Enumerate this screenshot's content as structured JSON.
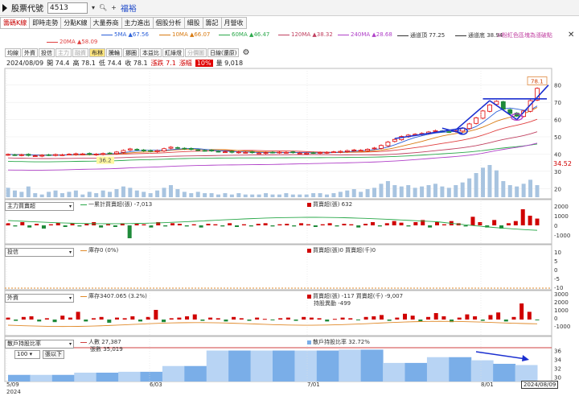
{
  "toolbar": {
    "label": "股票代號",
    "code": "4513",
    "stock_name": "福裕"
  },
  "tabs": [
    "籌碼K線",
    "即時走勢",
    "分點K線",
    "大量券商",
    "主力進出",
    "個股分析",
    "細股",
    "籌記",
    "月營收"
  ],
  "ma_legend": {
    "ma5": "5MA ▲67.56",
    "ma10": "10MA ▲66.07",
    "ma60": "60MA ▲46.47",
    "ma120": "120MA ▲38.32",
    "ma240": "240MA ▲28.68",
    "upper": "通道頂 77.25",
    "lower": "通道底 38.94",
    "ma20": "20MA ▲58.09",
    "link": "⊙粉紅色區塊為漲破點",
    "colors": {
      "ma5": "#2a5fd8",
      "ma10": "#d87a10",
      "ma60": "#2aa84a",
      "ma120": "#c04060",
      "ma240": "#b040c8",
      "upper": "#333333",
      "lower": "#333333",
      "ma20": "#e04040"
    }
  },
  "subtabs": [
    "均線",
    "外資",
    "投信",
    "主力",
    "融資",
    "布林",
    "騰輪",
    "挪圈",
    "本益比",
    "紅綠燈",
    "分價圖",
    "日線(還原)"
  ],
  "quote": {
    "date": "2024/08/09",
    "open": "開 74.4",
    "high": "高 78.1",
    "low": "低 74.4",
    "close": "收 78.1",
    "change": "漲跌 7.1",
    "pct_label": "漲幅",
    "pct": "10%",
    "volume": "量 9,018"
  },
  "price_axis": [
    "80",
    "70",
    "60",
    "50",
    "40",
    "30",
    "20"
  ],
  "price_tags": {
    "high": "78.1",
    "low": "36.2",
    "level": "34.52"
  },
  "panels": {
    "main_force": {
      "select": "主力買賣超",
      "cum": "一累計買賣超(張) -7,013",
      "bar": "買賣超(張) 632",
      "axis": [
        "2000",
        "1000",
        "0",
        "-1000"
      ]
    },
    "trust": {
      "select": "投信",
      "hold": "庫存0 (0%)",
      "bar": "買賣超(張)0 買賣超(千)0",
      "axis": [
        "10",
        "5",
        "0",
        "-5",
        "-10"
      ]
    },
    "foreign": {
      "select": "外資",
      "hold": "庫存3407.065 (3.2%)",
      "bar": "買賣超(張) -117 買賣超(千) -9,007",
      "sub": "持股異動 -499",
      "axis": [
        "3000",
        "2000",
        "1000",
        "0",
        "-1000"
      ]
    },
    "holders": {
      "select": "散戶持股比率",
      "count": "人數 27,387",
      "count2": "張數 35,019",
      "ratio": "散戶持股比率 32.72%",
      "axis": [
        "36",
        "34",
        "32",
        "30"
      ],
      "period": "100",
      "btn": "張以下"
    }
  },
  "x_axis": {
    "labels": [
      "5/09",
      "6/03",
      "7/01",
      "8/01"
    ],
    "year": "2024",
    "current": "2024/08/09"
  },
  "chart_data": {
    "type": "candlestick",
    "period": "daily",
    "x_start": "2024/05/09",
    "x_end": "2024/08/09",
    "ylim": [
      15,
      85
    ],
    "ylabel_ticks": [
      20,
      30,
      40,
      50,
      60,
      70,
      80
    ],
    "close_prices": [
      39.8,
      39.5,
      39.6,
      39.2,
      39.0,
      39.3,
      39.4,
      39.7,
      39.6,
      39.9,
      40.2,
      40.1,
      39.8,
      40.0,
      40.3,
      40.5,
      41.2,
      42.1,
      43.0,
      42.6,
      41.8,
      41.6,
      42.0,
      43.1,
      44.0,
      43.6,
      43.0,
      42.7,
      42.3,
      42.0,
      41.8,
      41.5,
      41.3,
      41.0,
      41.2,
      41.0,
      40.8,
      40.6,
      40.8,
      40.9,
      41.1,
      41.0,
      40.8,
      40.6,
      40.5,
      40.7,
      40.9,
      41.0,
      41.3,
      41.6,
      42.0,
      42.4,
      42.2,
      42.8,
      43.5,
      45.0,
      47.0,
      48.5,
      50.2,
      51.0,
      51.5,
      52.0,
      52.8,
      53.6,
      53.2,
      52.8,
      53.5,
      55.0,
      57.5,
      61.0,
      65.0,
      68.5,
      70.6,
      66.0,
      63.5,
      62.0,
      65.0,
      71.0,
      78.1
    ],
    "volume": [
      7,
      5,
      4,
      8,
      3,
      2,
      4,
      5,
      3,
      4,
      5,
      2,
      4,
      3,
      5,
      4,
      6,
      8,
      7,
      5,
      4,
      3,
      5,
      7,
      9,
      6,
      4,
      3,
      4,
      3,
      3,
      2,
      3,
      2,
      3,
      2,
      2,
      2,
      3,
      2,
      2,
      3,
      2,
      2,
      2,
      3,
      3,
      2,
      3,
      4,
      5,
      6,
      4,
      6,
      7,
      10,
      12,
      9,
      8,
      9,
      7,
      8,
      9,
      10,
      8,
      7,
      9,
      11,
      14,
      18,
      22,
      24,
      20,
      12,
      9,
      8,
      10,
      13,
      9
    ],
    "trendlines": "blue channel drawn on recent rally",
    "main_force_net": [
      200,
      -100,
      300,
      -200,
      150,
      -300,
      100,
      250,
      -150,
      200,
      -100,
      150,
      300,
      -200,
      100,
      -150,
      200,
      -1200,
      150,
      100,
      -200,
      300,
      -100,
      200,
      150,
      -100,
      100,
      -200,
      150,
      100,
      -100,
      200,
      -150,
      100,
      -100,
      150,
      200,
      -100,
      100,
      150,
      -100,
      200,
      100,
      -150,
      100,
      200,
      -100,
      150,
      100,
      -200,
      150,
      300,
      -100,
      200,
      400,
      250,
      -100,
      300,
      500,
      -200,
      300,
      100,
      400,
      200,
      -100,
      800,
      300,
      -200,
      500,
      -300,
      200,
      400,
      1500,
      900,
      632
    ],
    "foreign_net": [
      300,
      -200,
      400,
      500,
      -300,
      200,
      -400,
      600,
      300,
      1200,
      -300,
      200,
      400,
      -500,
      300,
      200,
      500,
      -300,
      400,
      1500,
      -400,
      200,
      300,
      500,
      800,
      -200,
      300,
      200,
      -300,
      400,
      200,
      -200,
      300,
      100,
      -100,
      200,
      300,
      -200,
      400,
      300,
      200,
      -300,
      100,
      300,
      200,
      -100,
      400,
      500,
      700,
      -200,
      300,
      900,
      600,
      -300,
      400,
      1000,
      500,
      -400,
      300,
      800,
      500,
      -200,
      700,
      1100,
      -300,
      400,
      2500,
      1200,
      -117
    ],
    "retail_ratio": [
      30.5,
      30.5,
      30.5,
      31.0,
      31.0,
      31.2,
      31.2,
      32.5,
      32.5,
      36.0,
      36.0,
      36.0,
      36.0,
      36.0,
      36.0,
      36.2,
      36.2,
      33.2,
      33.2,
      34.5,
      34.5,
      33.8,
      33.0,
      32.72
    ]
  }
}
